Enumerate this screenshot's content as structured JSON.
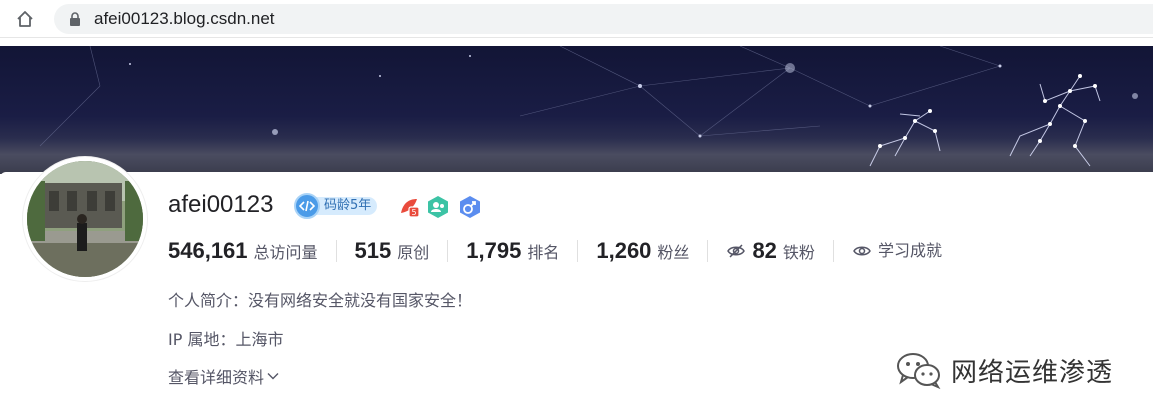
{
  "browser": {
    "url": "afei00123.blog.csdn.net"
  },
  "profile": {
    "username": "afei00123",
    "code_age_label": "码龄5年",
    "stats": [
      {
        "value": "546,161",
        "label": "总访问量"
      },
      {
        "value": "515",
        "label": "原创"
      },
      {
        "value": "1,795",
        "label": "排名"
      },
      {
        "value": "1,260",
        "label": "粉丝"
      },
      {
        "value": "82",
        "label": "铁粉"
      },
      {
        "value": "",
        "label": "学习成就"
      }
    ],
    "bio": "个人简介：没有网络安全就没有国家安全！",
    "ip_location": "IP 属地：上海市",
    "more_info": "查看详细资料"
  },
  "watermark": {
    "text": "网络运维渗透"
  },
  "colors": {
    "banner_dark": "#121536",
    "code_age_blue": "#4b9be8",
    "badge_red": "#e94b3c",
    "badge_green": "#3cc3a5",
    "badge_blue": "#5b8def"
  }
}
